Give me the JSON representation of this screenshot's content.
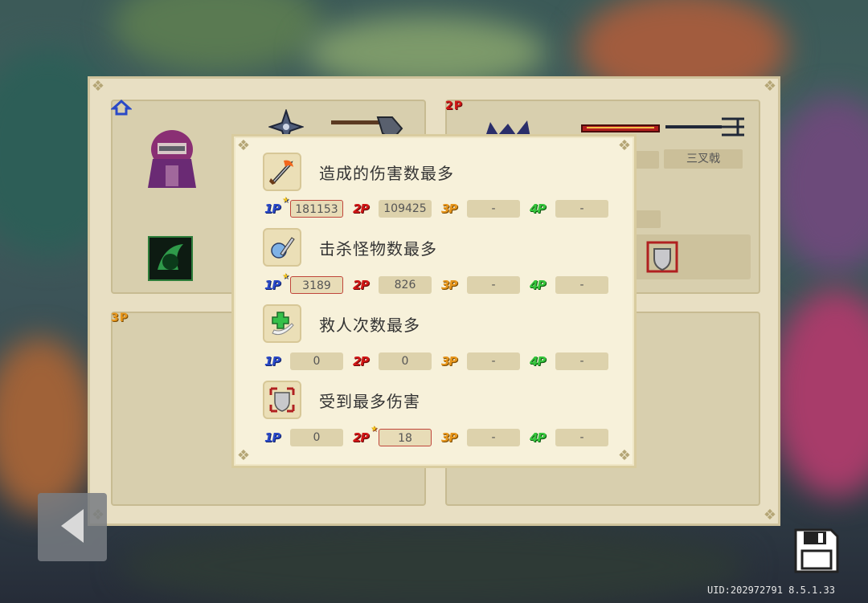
{
  "players": {
    "p1_tag": "1P",
    "p2_tag": "2P",
    "p3_tag": "3P",
    "p2_weapon_label": "三叉戟"
  },
  "popup": {
    "categories": [
      {
        "title": "造成的伤害数最多",
        "icon": "flaming-sword-icon",
        "values": [
          "181153",
          "109425",
          "-",
          "-"
        ],
        "best": "1P"
      },
      {
        "title": "击杀怪物数最多",
        "icon": "ghost-sword-icon",
        "values": [
          "3189",
          "826",
          "-",
          "-"
        ],
        "best": "1P"
      },
      {
        "title": "救人次数最多",
        "icon": "medic-cross-icon",
        "values": [
          "0",
          "0",
          "-",
          "-"
        ],
        "best": ""
      },
      {
        "title": "受到最多伤害",
        "icon": "cracked-shield-icon",
        "values": [
          "0",
          "18",
          "-",
          "-"
        ],
        "best": "2P"
      }
    ],
    "player_labels": [
      "1P",
      "2P",
      "3P",
      "4P"
    ]
  },
  "footer": {
    "uid_text": "UID:202972791 8.5.1.33"
  },
  "colors": {
    "p1": "#2a49c7",
    "p2": "#d11616",
    "p3": "#e6951b",
    "p4": "#35c43c",
    "best_border": "#c0463b"
  }
}
